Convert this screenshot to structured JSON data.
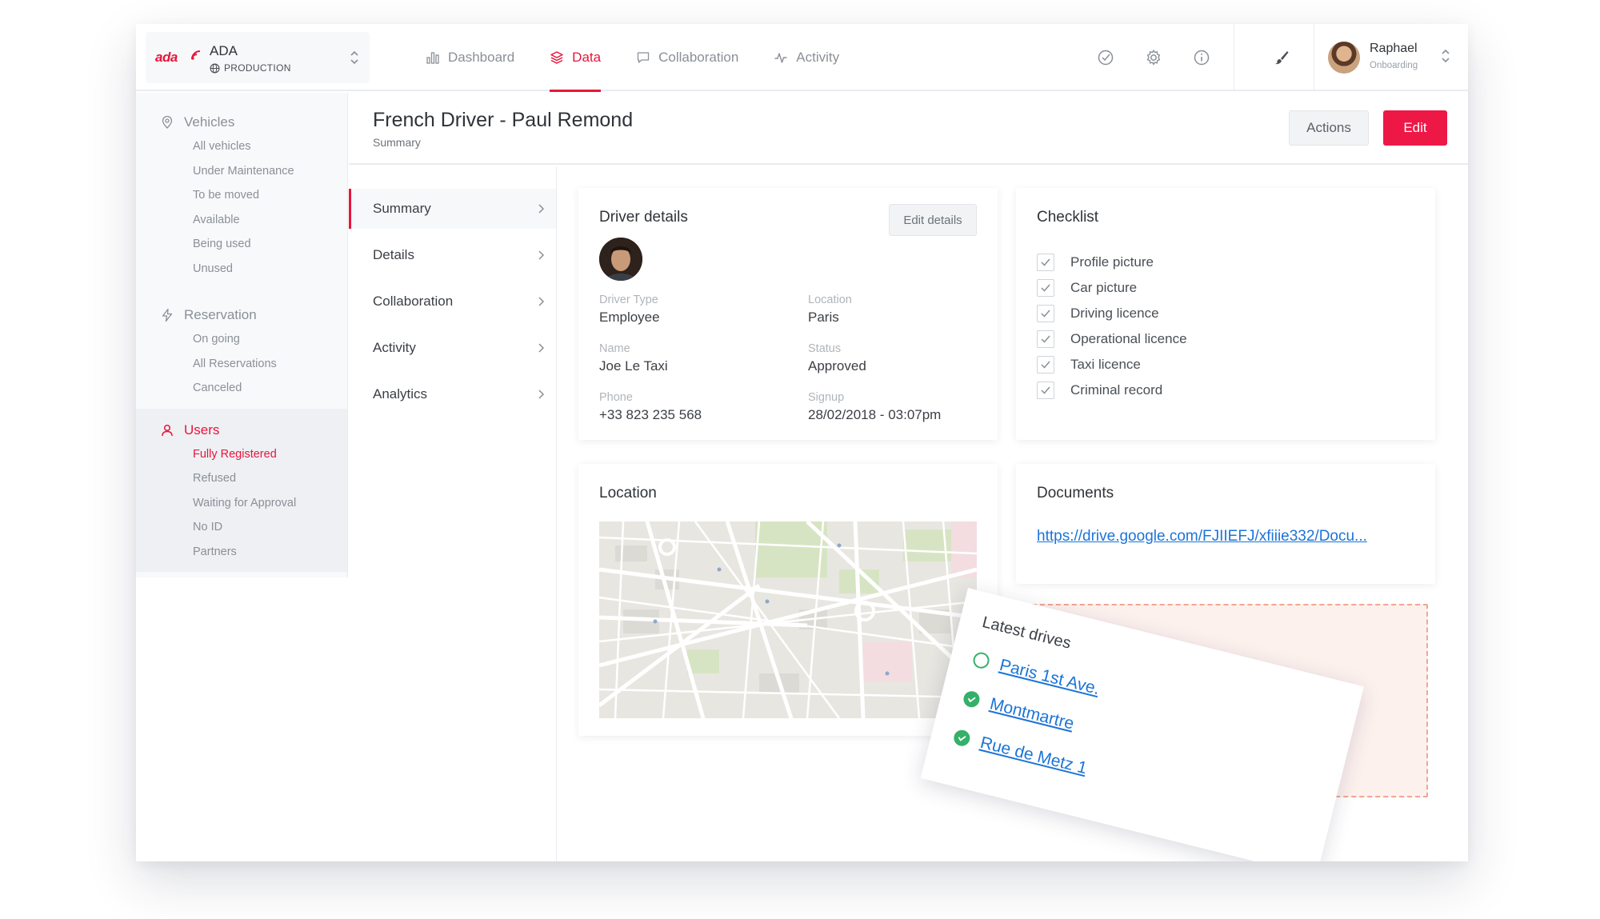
{
  "app": {
    "logo_text": "ada",
    "name": "ADA",
    "environment": "PRODUCTION"
  },
  "nav": [
    {
      "label": "Dashboard",
      "icon": "bar-chart-icon"
    },
    {
      "label": "Data",
      "icon": "layers-icon",
      "active": true
    },
    {
      "label": "Collaboration",
      "icon": "chat-icon"
    },
    {
      "label": "Activity",
      "icon": "activity-icon"
    }
  ],
  "tools": [
    "check-circle-icon",
    "gear-icon",
    "info-icon",
    "brush-icon"
  ],
  "user": {
    "name": "Raphael",
    "role": "Onboarding"
  },
  "sidebar": {
    "vehicles": {
      "title": "Vehicles",
      "items": [
        "All vehicles",
        "Under Maintenance",
        "To be moved",
        "Available",
        "Being used",
        "Unused"
      ]
    },
    "reservation": {
      "title": "Reservation",
      "items": [
        "On going",
        "All Reservations",
        "Canceled"
      ]
    },
    "users": {
      "title": "Users",
      "items": [
        "Fully Registered",
        "Refused",
        "Waiting for Approval",
        "No ID",
        "Partners"
      ],
      "active_index": 0
    }
  },
  "page": {
    "title": "French Driver - Paul Remond",
    "subtitle": "Summary",
    "actions_label": "Actions",
    "edit_label": "Edit"
  },
  "submenu": [
    "Summary",
    "Details",
    "Collaboration",
    "Activity",
    "Analytics"
  ],
  "driver_details": {
    "title": "Driver details",
    "edit_label": "Edit details",
    "fields": {
      "driver_type": {
        "label": "Driver Type",
        "value": "Employee"
      },
      "location": {
        "label": "Location",
        "value": "Paris"
      },
      "name": {
        "label": "Name",
        "value": "Joe Le Taxi"
      },
      "status": {
        "label": "Status",
        "value": "Approved"
      },
      "phone": {
        "label": "Phone",
        "value": "+33 823 235 568"
      },
      "signup": {
        "label": "Signup",
        "value": "28/02/2018 - 03:07pm"
      }
    }
  },
  "checklist": {
    "title": "Checklist",
    "items": [
      "Profile picture",
      "Car picture",
      "Driving licence",
      "Operational licence",
      "Taxi licence",
      "Criminal record"
    ]
  },
  "location": {
    "title": "Location"
  },
  "documents": {
    "title": "Documents",
    "link": "https://drive.google.com/FJIIEFJ/xfiiie332/Docu..."
  },
  "latest_drives": {
    "title": "Latest drives",
    "items": [
      {
        "label": "Paris 1st Ave.",
        "status": "open"
      },
      {
        "label": "Montmartre",
        "status": "done"
      },
      {
        "label": "Rue de Metz 1",
        "status": "done"
      }
    ]
  },
  "colors": {
    "accent": "#e8153b",
    "link": "#1b74d8",
    "success": "#35b06a"
  }
}
